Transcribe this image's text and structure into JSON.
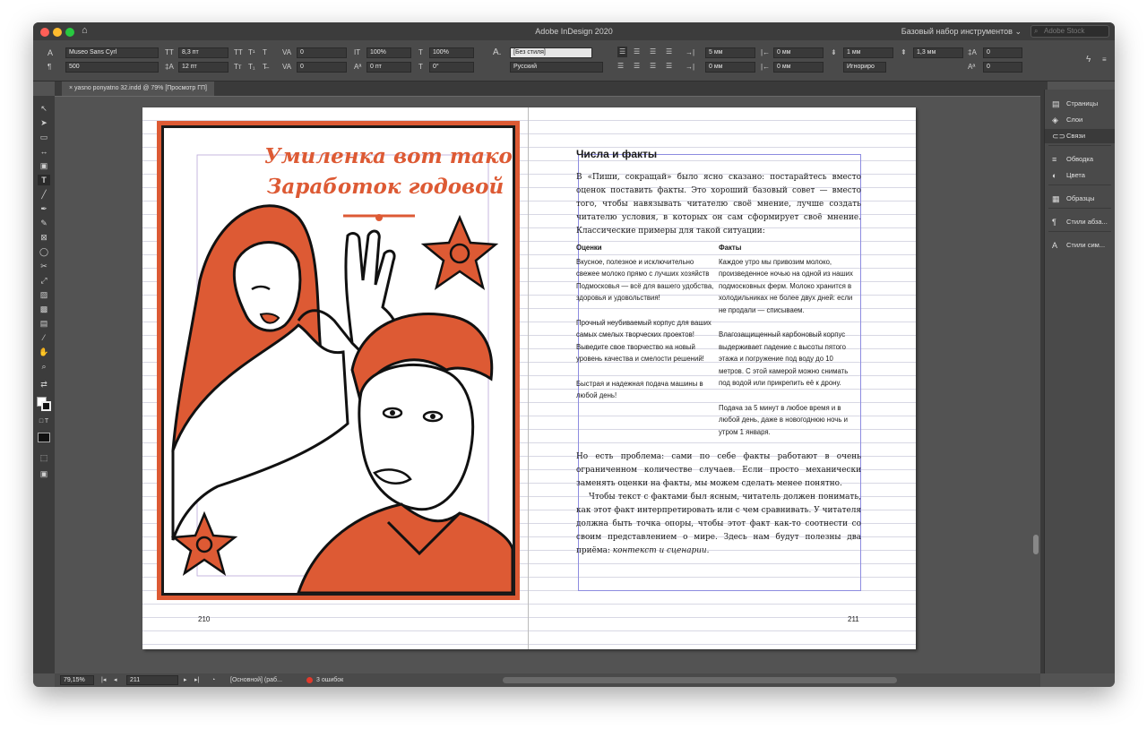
{
  "app": {
    "title": "Adobe InDesign 2020",
    "workspace": "Базовый набор инструментов",
    "stock_placeholder": "Adobe Stock"
  },
  "controlbar": {
    "font_family": "Museo Sans Cyrl",
    "font_style": "500",
    "font_size": "8,3 пт",
    "leading": "12 пт",
    "kerning": "0",
    "tracking": "0",
    "vscale": "100%",
    "hscale": "100%",
    "baseline": "0 пт",
    "skew": "0°",
    "char_style": "[Без стиля]",
    "language": "Русский",
    "indent_left": "5 мм",
    "indent_right": "0 мм",
    "indent_first": "0 мм",
    "indent_last": "0 мм",
    "space_before": "1 мм",
    "space_after": "1,3 мм",
    "align_to_grid": "Игнориро",
    "dropcap_lines": "0",
    "dropcap_chars": "0"
  },
  "tab": {
    "label": "yasno ponyatno 32.indd @ 79% [Просмотр ГП]"
  },
  "illustration": {
    "title_line1": "Умиленка вот такой",
    "title_line2": "Заработок годовой",
    "brand_color": "#dd5a34"
  },
  "page_left": {
    "folio": "210"
  },
  "page_right": {
    "folio": "211",
    "heading": "Числа и факты",
    "para1": "В «Пиши, сокращай» было ясно сказано: постарайтесь вместо оценок поставить факты. Это хороший базовый совет — вместо того, чтобы навязывать читателю своё мнение, лучше создать читателю условия, в которых он сам сформирует своё мнение. Классические примеры для такой ситуации:",
    "facts": {
      "col1_header": "Оценки",
      "col2_header": "Факты",
      "rows": [
        {
          "opinion": "Вкусное, полезное и исключительно свежее молоко прямо с лучших хозяйств Подмосковья — всё для вашего удобства, здоровья и удовольствия!",
          "fact": "Каждое утро мы привозим молоко, произведенное ночью на одной из наших подмосковных ферм. Молоко хранится в холодильниках не более двух дней: если не продали — списываем."
        },
        {
          "opinion": "Прочный неубиваемый корпус для ваших самых смелых творческих проектов! Выведите свое творчество на новый уровень качества и смелости решений!",
          "fact": "Влагозащищенный карбоновый корпус выдерживает падение с высоты пятого этажа и погружение под воду до 10 метров. С этой камерой можно снимать под водой или прикрепить её к дрону."
        },
        {
          "opinion": "Быстрая и надежная подача машины в любой день!",
          "fact": "Подача за 5 минут в любое время и в любой день, даже в новогоднюю ночь и утром 1 января."
        }
      ]
    },
    "para2": "Но есть проблема: сами по себе факты работают в очень ограниченном количестве случаев. Если просто механически заменять оценки на факты, мы можем сделать менее понятно.",
    "para3": "Чтобы текст с фактами был ясным, читатель должен понимать, как этот факт интерпретировать или с чем сравнивать. У читателя должна быть точка опоры, чтобы этот факт как-то соотнести со своим представлением о мире. Здесь нам будут полезны два приёма:",
    "para3_italic": "контекст и сценарии."
  },
  "panels": [
    {
      "label": "Страницы",
      "icon": "pages-icon",
      "glyph": "▤"
    },
    {
      "label": "Слои",
      "icon": "layers-icon",
      "glyph": "◈"
    },
    {
      "label": "Связи",
      "icon": "links-icon",
      "glyph": "⊂⊃"
    },
    {
      "label": "Обводка",
      "icon": "stroke-icon",
      "glyph": "≡"
    },
    {
      "label": "Цвета",
      "icon": "swatches-icon",
      "glyph": "◐"
    },
    {
      "label": "Образцы",
      "icon": "samples-icon",
      "glyph": "▦"
    },
    {
      "label": "Стили абза...",
      "icon": "paragraph-styles-icon",
      "glyph": "¶"
    },
    {
      "label": "Стили сим...",
      "icon": "character-styles-icon",
      "glyph": "A"
    }
  ],
  "statusbar": {
    "zoom": "79,15%",
    "page": "211",
    "preflight_profile": "[Основной] (раб...",
    "errors": "3 ошибок"
  }
}
